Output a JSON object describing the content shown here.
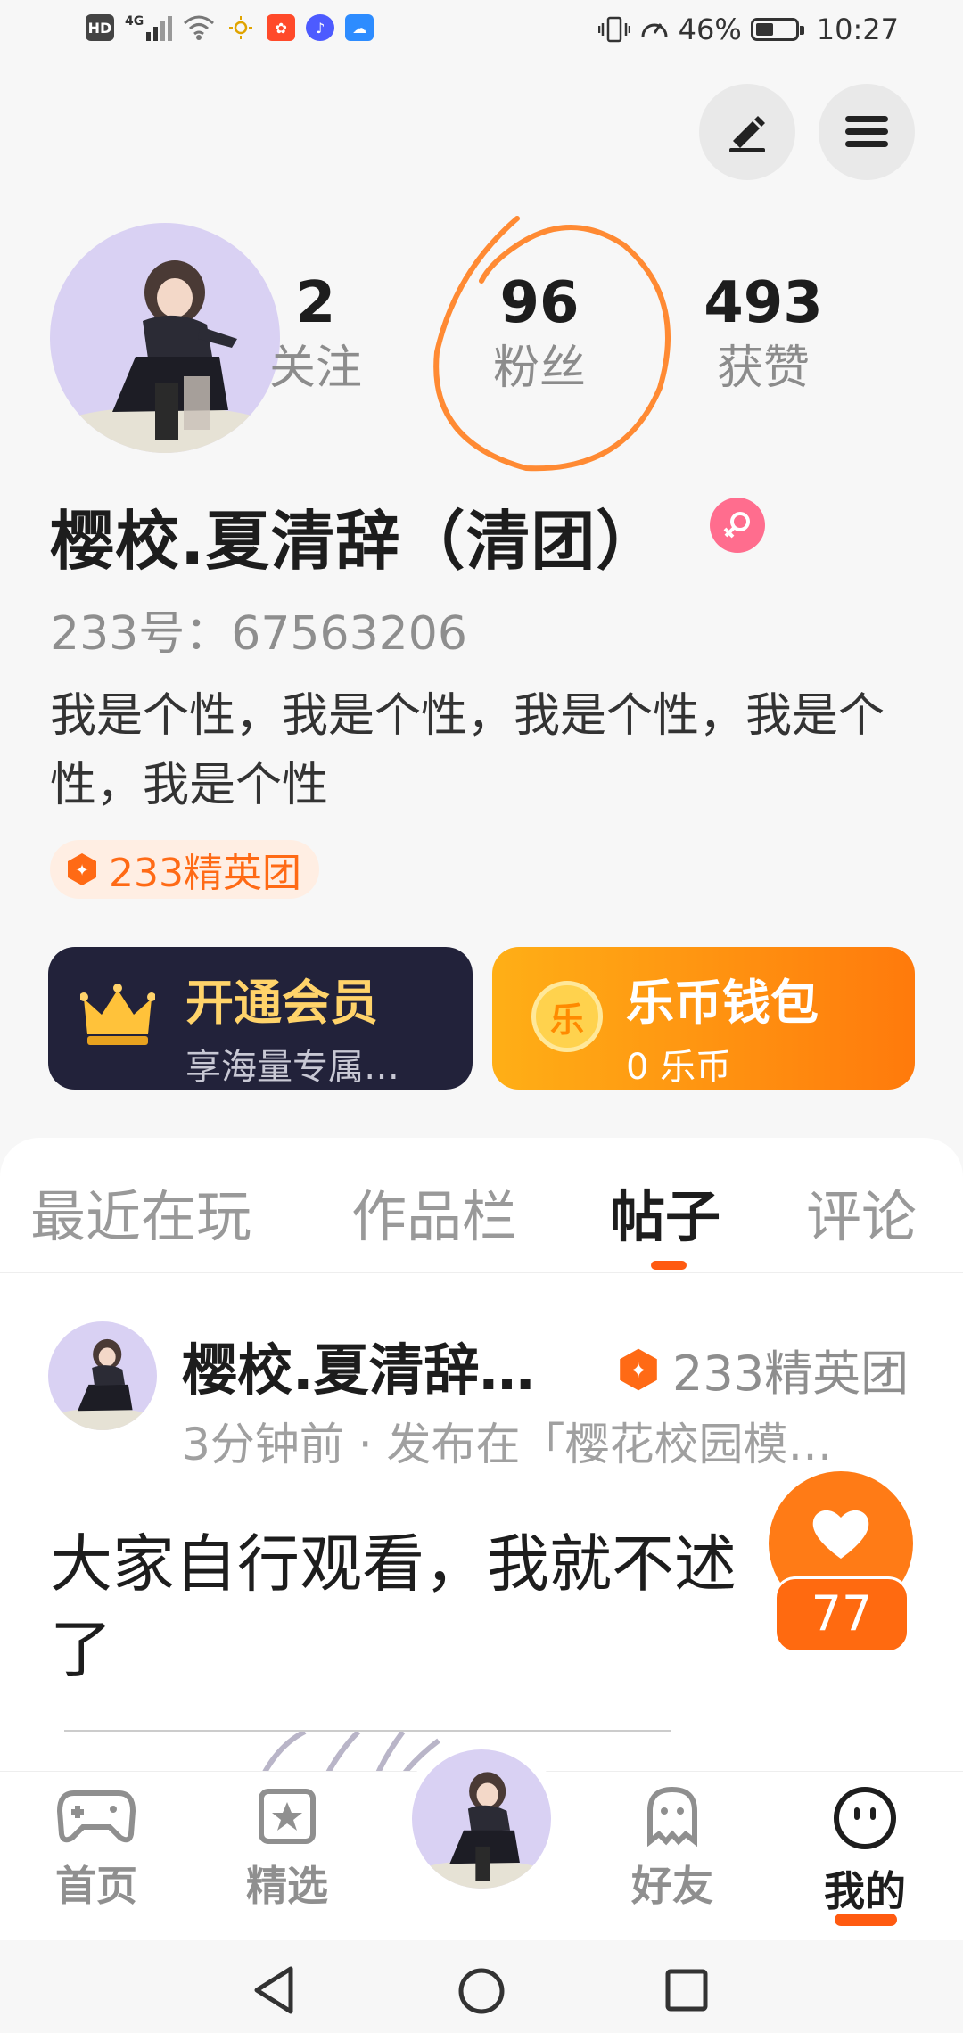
{
  "status_bar": {
    "left_icons": [
      "hd-icon",
      "signal-4g-icon",
      "wifi-icon",
      "weather-icon",
      "app-notification-icon",
      "music-icon",
      "cloud-weather-icon"
    ],
    "network_label": "4G",
    "hd_label": "HD",
    "battery_percent": "46%",
    "battery_level": 0.46,
    "time": "10:27"
  },
  "profile": {
    "stats": [
      {
        "value": "2",
        "label": "关注"
      },
      {
        "value": "96",
        "label": "粉丝"
      },
      {
        "value": "493",
        "label": "获赞"
      }
    ],
    "username": "樱校.夏清辞（清团）",
    "id_label": "233号：67563206",
    "bio": "我是个性，我是个性，我是个性，我是个性，我是个性",
    "elite_tag": "233精英团"
  },
  "cards": {
    "vip": {
      "title": "开通会员",
      "subtitle": "享海量专属…"
    },
    "wallet": {
      "title": "乐币钱包",
      "subtitle": "0 乐币",
      "coin_char": "乐"
    }
  },
  "tabs": [
    {
      "label": "最近在玩",
      "active": false
    },
    {
      "label": "作品栏",
      "active": false
    },
    {
      "label": "帖子",
      "active": true
    },
    {
      "label": "评论",
      "active": false
    }
  ],
  "post": {
    "author": "樱校.夏清辞…",
    "tag": "233精英团",
    "meta": "3分钟前 · 发布在「樱花校园模…",
    "body": "大家自行观看，我就不述\n了",
    "likes": "77"
  },
  "bottom_nav": [
    {
      "label": "首页",
      "icon": "gamepad-icon",
      "active": false
    },
    {
      "label": "精选",
      "icon": "star-card-icon",
      "active": false
    },
    {
      "label": "好友",
      "icon": "ghost-icon",
      "active": false
    },
    {
      "label": "我的",
      "icon": "smiley-icon",
      "active": true
    }
  ],
  "colors": {
    "accent": "#ff6a15",
    "annotation_circle": "#ff8a33",
    "vip_bg": "#22223a",
    "vip_gold": "#ffd36a",
    "gender_pink": "#ff6d8e"
  }
}
